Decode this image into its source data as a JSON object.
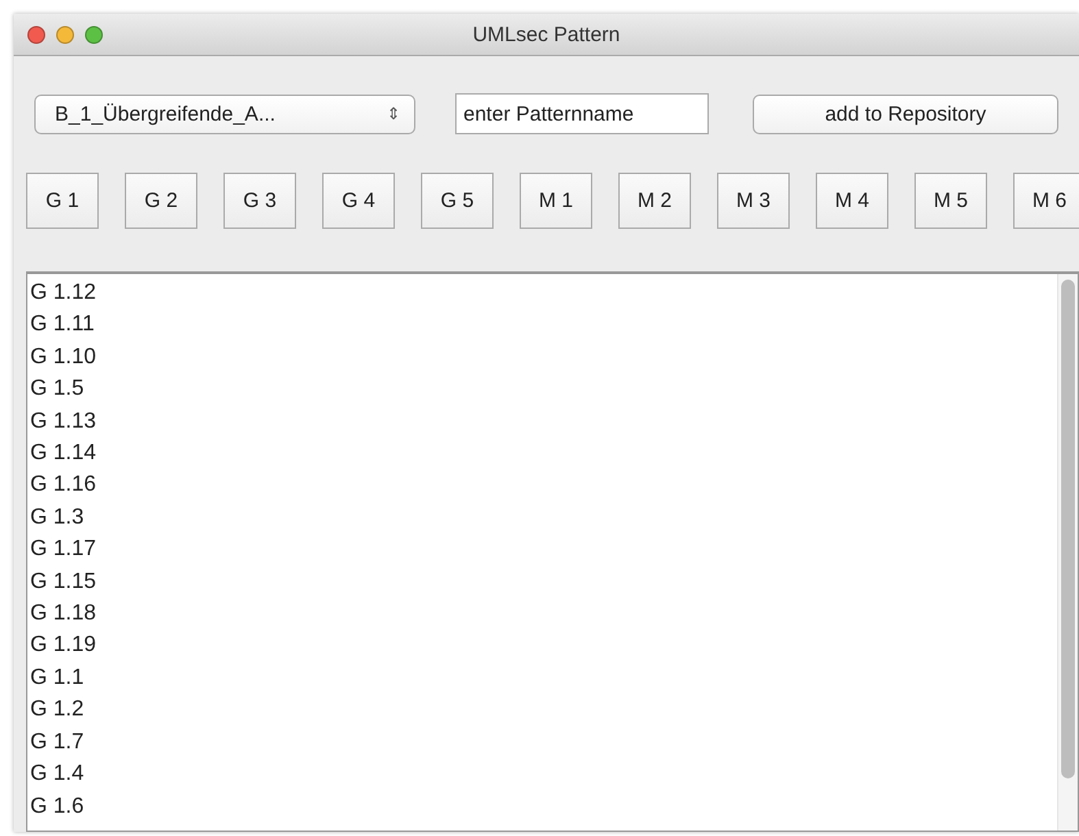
{
  "window": {
    "title": "UMLsec Pattern"
  },
  "pattern_select": {
    "value": "B_1_Übergreifende_A...",
    "arrow": "⇕"
  },
  "pattern_name": {
    "value": "enter Patternname"
  },
  "add_button": {
    "label": "add to Repository"
  },
  "group_buttons": [
    "G 1",
    "G 2",
    "G 3",
    "G 4",
    "G 5",
    "M 1",
    "M 2",
    "M 3",
    "M 4",
    "M 5",
    "M 6"
  ],
  "list": {
    "items": [
      "G 1.12",
      "G 1.11",
      "G 1.10",
      "G 1.5",
      "G 1.13",
      "G 1.14",
      "G 1.16",
      "G 1.3",
      "G 1.17",
      "G 1.15",
      "G 1.18",
      "G 1.19",
      "G 1.1",
      "G 1.2",
      "G 1.7",
      "G 1.4",
      "G 1.6"
    ]
  }
}
